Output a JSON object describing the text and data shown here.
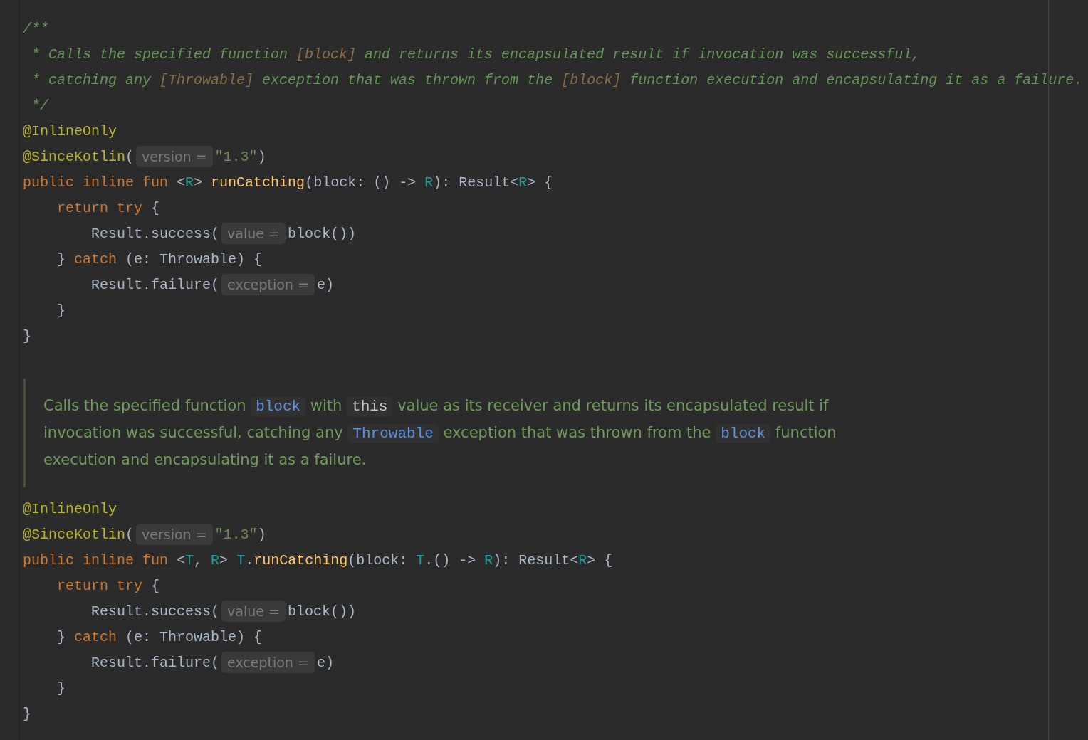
{
  "editor": {
    "blocks": [
      {
        "kind": "code",
        "lines": [
          {
            "tokens": [
              {
                "kind": "comment",
                "text": "/**"
              }
            ]
          },
          {
            "tokens": [
              {
                "kind": "comment",
                "text": " * Calls the specified function "
              },
              {
                "kind": "comment_link",
                "text": "[block]"
              },
              {
                "kind": "comment",
                "text": " and returns its encapsulated result if invocation was successful,"
              }
            ]
          },
          {
            "tokens": [
              {
                "kind": "comment",
                "text": " * catching any "
              },
              {
                "kind": "comment_link",
                "text": "[Throwable]"
              },
              {
                "kind": "comment",
                "text": " exception that was thrown from the "
              },
              {
                "kind": "comment_link",
                "text": "[block]"
              },
              {
                "kind": "comment",
                "text": " function execution and encapsulating it as a failure."
              }
            ]
          },
          {
            "tokens": [
              {
                "kind": "comment",
                "text": " */"
              }
            ]
          },
          {
            "tokens": [
              {
                "kind": "annotation",
                "text": "@InlineOnly"
              }
            ]
          },
          {
            "tokens": [
              {
                "kind": "annotation",
                "text": "@SinceKotlin"
              },
              {
                "kind": "plain",
                "text": "("
              },
              {
                "kind": "hint",
                "text": "version ="
              },
              {
                "kind": "string",
                "text": "\"1.3\""
              },
              {
                "kind": "plain",
                "text": ")"
              }
            ]
          },
          {
            "tokens": [
              {
                "kind": "keyword",
                "text": "public inline fun "
              },
              {
                "kind": "plain",
                "text": "<"
              },
              {
                "kind": "type_param",
                "text": "R"
              },
              {
                "kind": "plain",
                "text": "> "
              },
              {
                "kind": "function",
                "text": "runCatching"
              },
              {
                "kind": "plain",
                "text": "(block: () -> "
              },
              {
                "kind": "type_param",
                "text": "R"
              },
              {
                "kind": "plain",
                "text": "): Result<"
              },
              {
                "kind": "type_param",
                "text": "R"
              },
              {
                "kind": "plain",
                "text": "> {"
              }
            ]
          },
          {
            "tokens": [
              {
                "kind": "keyword",
                "text": "    return try "
              },
              {
                "kind": "plain",
                "text": "{"
              }
            ]
          },
          {
            "tokens": [
              {
                "kind": "plain",
                "text": "        Result.success("
              },
              {
                "kind": "hint",
                "text": "value ="
              },
              {
                "kind": "plain",
                "text": "block())"
              }
            ]
          },
          {
            "tokens": [
              {
                "kind": "plain",
                "text": "    } "
              },
              {
                "kind": "keyword",
                "text": "catch"
              },
              {
                "kind": "plain",
                "text": " (e: Throwable) {"
              }
            ]
          },
          {
            "tokens": [
              {
                "kind": "plain",
                "text": "        Result.failure("
              },
              {
                "kind": "hint",
                "text": "exception ="
              },
              {
                "kind": "plain",
                "text": "e)"
              }
            ]
          },
          {
            "tokens": [
              {
                "kind": "plain",
                "text": "    }"
              }
            ]
          },
          {
            "tokens": [
              {
                "kind": "plain",
                "text": "}"
              }
            ]
          }
        ]
      },
      {
        "kind": "doc",
        "parts": [
          {
            "kind": "text",
            "text": "Calls the specified function "
          },
          {
            "kind": "code_link",
            "text": "block"
          },
          {
            "kind": "text",
            "text": " with "
          },
          {
            "kind": "code",
            "text": "this"
          },
          {
            "kind": "text",
            "text": " value as its receiver and returns its encapsulated result if invocation was successful, catching any "
          },
          {
            "kind": "code_link",
            "text": "Throwable"
          },
          {
            "kind": "text",
            "text": " exception that was thrown from the "
          },
          {
            "kind": "code_link",
            "text": "block"
          },
          {
            "kind": "text",
            "text": " function execution and encapsulating it as a failure."
          }
        ]
      },
      {
        "kind": "code",
        "lines": [
          {
            "tokens": [
              {
                "kind": "annotation",
                "text": "@InlineOnly"
              }
            ]
          },
          {
            "tokens": [
              {
                "kind": "annotation",
                "text": "@SinceKotlin"
              },
              {
                "kind": "plain",
                "text": "("
              },
              {
                "kind": "hint",
                "text": "version ="
              },
              {
                "kind": "string",
                "text": "\"1.3\""
              },
              {
                "kind": "plain",
                "text": ")"
              }
            ]
          },
          {
            "tokens": [
              {
                "kind": "keyword",
                "text": "public inline fun "
              },
              {
                "kind": "plain",
                "text": "<"
              },
              {
                "kind": "type_param",
                "text": "T"
              },
              {
                "kind": "plain",
                "text": ", "
              },
              {
                "kind": "type_param",
                "text": "R"
              },
              {
                "kind": "plain",
                "text": "> "
              },
              {
                "kind": "type_param",
                "text": "T"
              },
              {
                "kind": "plain",
                "text": "."
              },
              {
                "kind": "function",
                "text": "runCatching"
              },
              {
                "kind": "plain",
                "text": "(block: "
              },
              {
                "kind": "type_param",
                "text": "T"
              },
              {
                "kind": "plain",
                "text": ".() -> "
              },
              {
                "kind": "type_param",
                "text": "R"
              },
              {
                "kind": "plain",
                "text": "): Result<"
              },
              {
                "kind": "type_param",
                "text": "R"
              },
              {
                "kind": "plain",
                "text": "> {"
              }
            ]
          },
          {
            "tokens": [
              {
                "kind": "keyword",
                "text": "    return try "
              },
              {
                "kind": "plain",
                "text": "{"
              }
            ]
          },
          {
            "tokens": [
              {
                "kind": "plain",
                "text": "        Result.success("
              },
              {
                "kind": "hint",
                "text": "value ="
              },
              {
                "kind": "plain",
                "text": "block())"
              }
            ]
          },
          {
            "tokens": [
              {
                "kind": "plain",
                "text": "    } "
              },
              {
                "kind": "keyword",
                "text": "catch"
              },
              {
                "kind": "plain",
                "text": " (e: Throwable) {"
              }
            ]
          },
          {
            "tokens": [
              {
                "kind": "plain",
                "text": "        Result.failure("
              },
              {
                "kind": "hint",
                "text": "exception ="
              },
              {
                "kind": "plain",
                "text": "e)"
              }
            ]
          },
          {
            "tokens": [
              {
                "kind": "plain",
                "text": "    }"
              }
            ]
          },
          {
            "tokens": [
              {
                "kind": "plain",
                "text": "}"
              }
            ]
          }
        ]
      }
    ]
  }
}
